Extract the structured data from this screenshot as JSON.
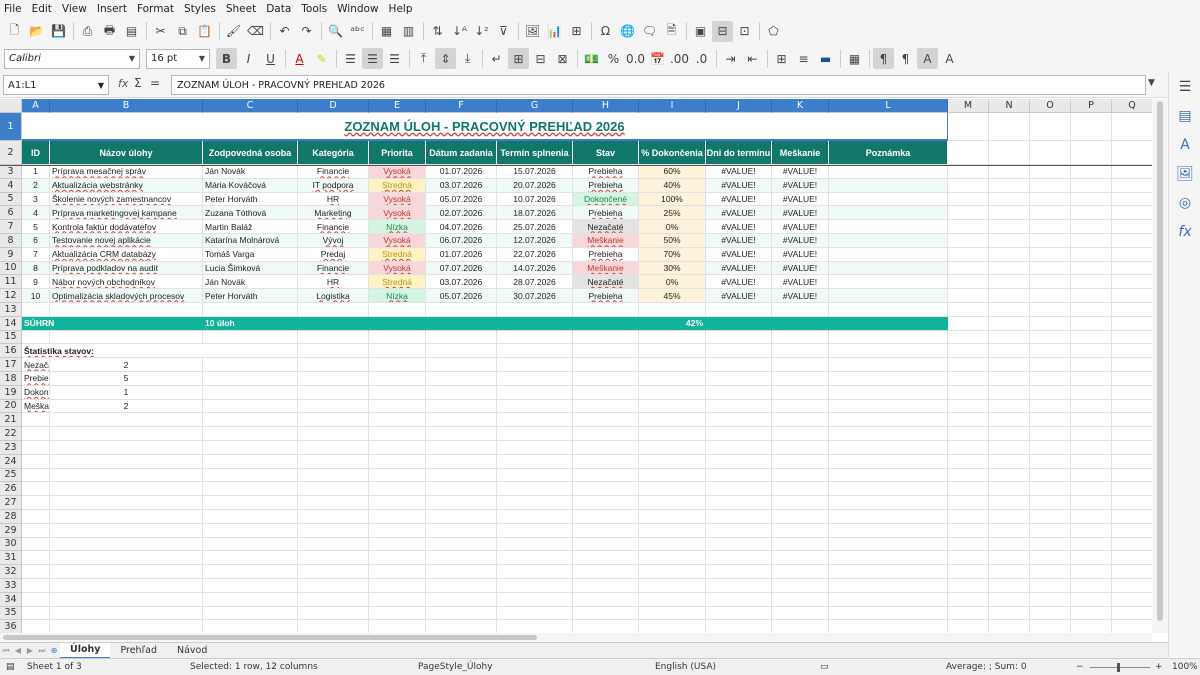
{
  "menu": [
    "File",
    "Edit",
    "View",
    "Insert",
    "Format",
    "Styles",
    "Sheet",
    "Data",
    "Tools",
    "Window",
    "Help"
  ],
  "toolbar": {
    "font": "Calibri",
    "size": "16 pt"
  },
  "formula": {
    "namebox": "A1:L1",
    "content": "ZOZNAM ÚLOH - PRACOVNÝ PREHĽAD 2026"
  },
  "columns": [
    "A",
    "B",
    "C",
    "D",
    "E",
    "F",
    "G",
    "H",
    "I",
    "J",
    "K",
    "L",
    "M",
    "N",
    "O",
    "P",
    "Q"
  ],
  "title": "ZOZNAM ÚLOH - PRACOVNÝ PREHĽAD 2026",
  "headers": [
    "ID",
    "Názov úlohy",
    "Zodpovedná osoba",
    "Kategória",
    "Priorita",
    "Dátum zadania",
    "Termín splnenia",
    "Stav",
    "% Dokončenia",
    "Dni do termínu",
    "Meškanie",
    "Poznámka"
  ],
  "tasks": [
    [
      "1",
      "Príprava mesačnej správ",
      "Ján Novák",
      "Financie",
      "Vysoká",
      "01.07.2026",
      "15.07.2026",
      "Prebieha",
      "60%",
      "#VALUE!",
      "#VALUE!",
      ""
    ],
    [
      "2",
      "Aktualizácia webstránky",
      "Mária Kováčová",
      "IT podpora",
      "Stredná",
      "03.07.2026",
      "20.07.2026",
      "Prebieha",
      "40%",
      "#VALUE!",
      "#VALUE!",
      ""
    ],
    [
      "3",
      "Školenie nových zamestnancov",
      "Peter Horváth",
      "HR",
      "Vysoká",
      "05.07.2026",
      "10.07.2026",
      "Dokončené",
      "100%",
      "#VALUE!",
      "#VALUE!",
      ""
    ],
    [
      "4",
      "Príprava marketingovej kampane",
      "Zuzana Tóthová",
      "Marketing",
      "Vysoká",
      "02.07.2026",
      "18.07.2026",
      "Prebieha",
      "25%",
      "#VALUE!",
      "#VALUE!",
      ""
    ],
    [
      "5",
      "Kontrola faktúr dodávateľov",
      "Martin Baláž",
      "Financie",
      "Nízka",
      "04.07.2026",
      "25.07.2026",
      "Nezačaté",
      "0%",
      "#VALUE!",
      "#VALUE!",
      ""
    ],
    [
      "6",
      "Testovanie novej aplikácie",
      "Katarína Molnárová",
      "Vývoj",
      "Vysoká",
      "06.07.2026",
      "12.07.2026",
      "Meškanie",
      "50%",
      "#VALUE!",
      "#VALUE!",
      ""
    ],
    [
      "7",
      "Aktualizácia CRM databázy",
      "Tomáš Varga",
      "Predaj",
      "Stredná",
      "01.07.2026",
      "22.07.2026",
      "Prebieha",
      "70%",
      "#VALUE!",
      "#VALUE!",
      ""
    ],
    [
      "8",
      "Príprava podkladov na audit",
      "Lucia Šimková",
      "Financie",
      "Vysoká",
      "07.07.2026",
      "14.07.2026",
      "Meškanie",
      "30%",
      "#VALUE!",
      "#VALUE!",
      ""
    ],
    [
      "9",
      "Nábor nových obchodníkov",
      "Ján Novák",
      "HR",
      "Stredná",
      "03.07.2026",
      "28.07.2026",
      "Nezačaté",
      "0%",
      "#VALUE!",
      "#VALUE!",
      ""
    ],
    [
      "10",
      "Optimalizácia skladových procesov",
      "Peter Horváth",
      "Logistika",
      "Nízka",
      "05.07.2026",
      "30.07.2026",
      "Prebieha",
      "45%",
      "#VALUE!",
      "#VALUE!",
      ""
    ]
  ],
  "summary": {
    "label": "SÚHRN",
    "count": "10 úloh",
    "pct": "42%"
  },
  "stats": {
    "title": "Štatistika stavov:",
    "rows": [
      [
        "Nezačaté",
        "2"
      ],
      [
        "Prebieha",
        "5"
      ],
      [
        "Dokončené",
        "1"
      ],
      [
        "Meškanie",
        "2"
      ]
    ]
  },
  "sheets": [
    "Úlohy",
    "Prehľad",
    "Návod"
  ],
  "status": {
    "sheet": "Sheet 1 of 3",
    "selection": "Selected: 1 row, 12 columns",
    "pagestyle": "PageStyle_Úlohy",
    "lang": "English (USA)",
    "sum": "Average: ; Sum: 0",
    "zoom": "100%"
  },
  "colors": {
    "header": "#11776b",
    "summary": "#12b39b",
    "high": "#f8d7da",
    "medium": "#fff3c4",
    "low": "#d5f5e3",
    "done": "#d5f5e3",
    "late": "#f8d7da",
    "notstarted": "#e3e3e3",
    "pct": "#fdf3da",
    "even": "#f0faf7",
    "selected": "#3b7ecb"
  }
}
